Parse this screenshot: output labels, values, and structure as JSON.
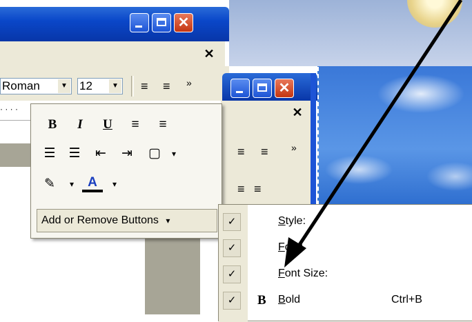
{
  "back_window": {
    "font_name": "Roman",
    "font_size": "12"
  },
  "popup": {
    "buttons": [
      {
        "name": "bold-button",
        "glyph": "B"
      },
      {
        "name": "italic-button",
        "glyph": "I"
      },
      {
        "name": "underline-button",
        "glyph": "U"
      },
      {
        "name": "align-right-button",
        "glyph": "≡"
      },
      {
        "name": "justify-button",
        "glyph": "≡"
      },
      {
        "name": "numbering-button",
        "glyph": "☰"
      },
      {
        "name": "bullets-button",
        "glyph": "☰"
      },
      {
        "name": "decrease-indent-button",
        "glyph": "⇤"
      },
      {
        "name": "increase-indent-button",
        "glyph": "⇥"
      },
      {
        "name": "border-button",
        "glyph": "▢"
      },
      {
        "name": "highlight-button",
        "glyph": "✎"
      },
      {
        "name": "font-color-button",
        "glyph": "A"
      }
    ],
    "add_remove_label": "Add or Remove Buttons",
    "dropdown_glyph": "▾"
  },
  "menu": {
    "items": [
      {
        "label": "Style:",
        "underline": "S",
        "rest": "tyle:",
        "checked": true,
        "icon": "",
        "shortcut": ""
      },
      {
        "label": "Font:",
        "underline": "F",
        "rest": "ont:",
        "checked": true,
        "icon": "",
        "shortcut": ""
      },
      {
        "label": "Font Size:",
        "underline": "F",
        "rest": "ont Size:",
        "checked": true,
        "icon": "",
        "shortcut": ""
      },
      {
        "label": "Bold",
        "underline": "B",
        "rest": "old",
        "checked": true,
        "icon": "B",
        "shortcut": "Ctrl+B"
      }
    ],
    "check_glyph": "✓"
  },
  "colors": {
    "xp_blue": "#0a47c9",
    "close_red": "#c43510",
    "toolbar_bg": "#ece9d8"
  }
}
